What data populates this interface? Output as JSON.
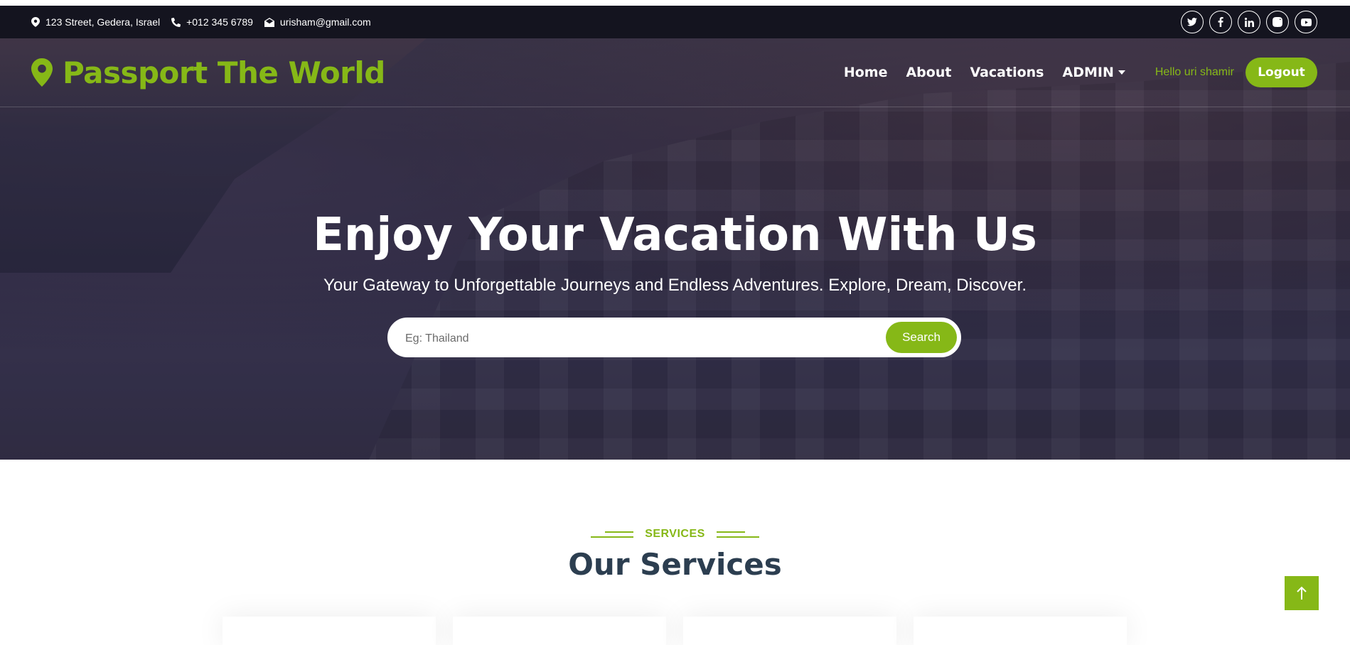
{
  "colors": {
    "accent": "#86b817",
    "topbar_bg": "#14141f",
    "heading": "#2c3e50"
  },
  "topbar": {
    "address": "123 Street, Gedera, Israel",
    "phone": "+012 345 6789",
    "email": "urisham@gmail.com",
    "socials": [
      "twitter-icon",
      "facebook-icon",
      "linkedin-icon",
      "instagram-icon",
      "youtube-icon"
    ]
  },
  "nav": {
    "brand": "Passport The World",
    "links": [
      "Home",
      "About",
      "Vacations",
      "ADMIN"
    ],
    "greeting": "Hello uri shamir",
    "logout_label": "Logout"
  },
  "hero": {
    "title": "Enjoy Your Vacation With Us",
    "subtitle": "Your Gateway to Unforgettable Journeys and Endless Adventures. Explore, Dream, Discover.",
    "search_placeholder": "Eg: Thailand",
    "search_label": "Search"
  },
  "services": {
    "tag": "SERVICES",
    "title": "Our Services"
  }
}
